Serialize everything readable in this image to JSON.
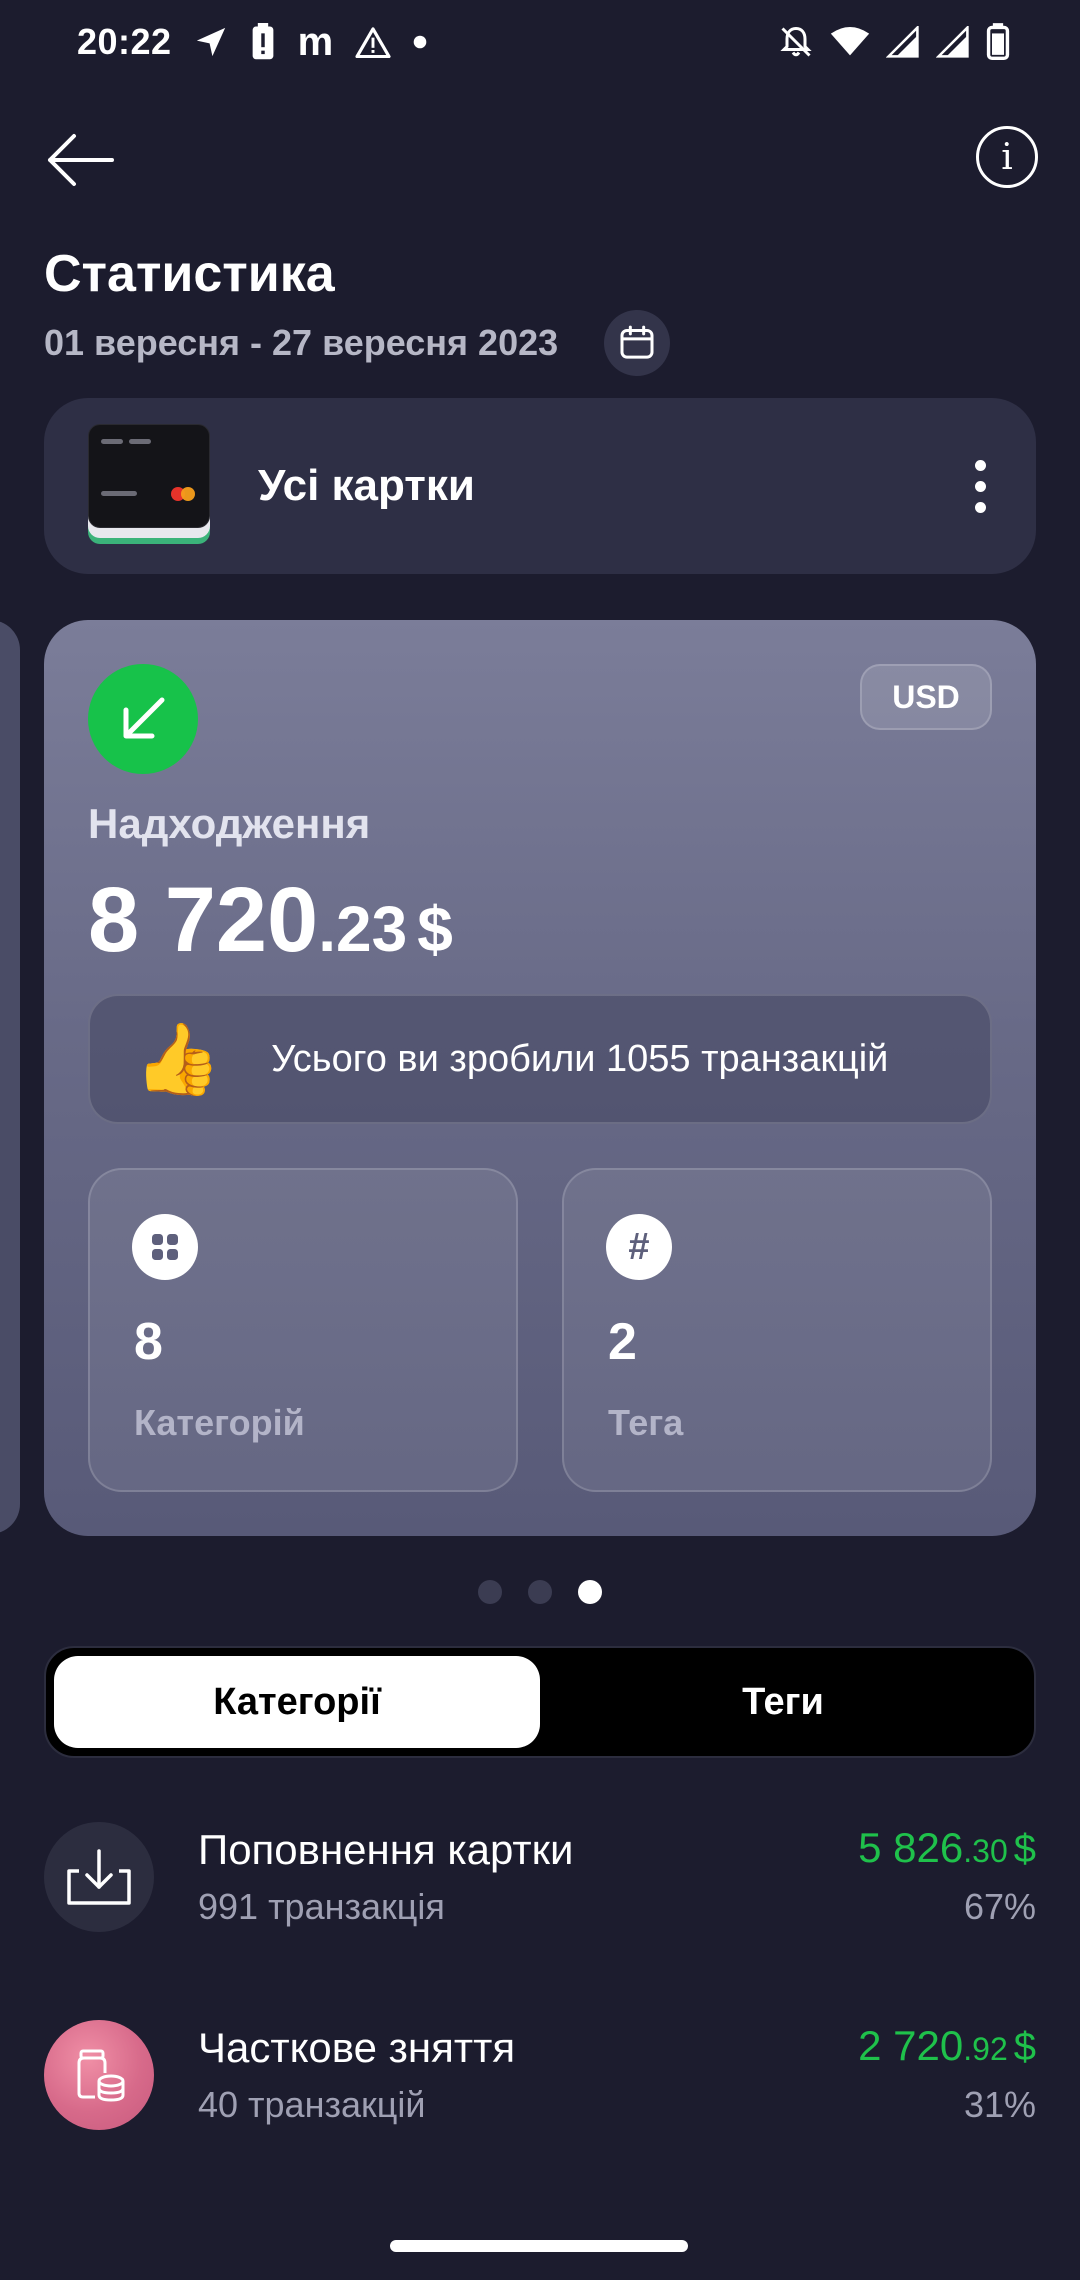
{
  "status_bar": {
    "time": "20:22",
    "left_icons": [
      "send-icon",
      "battery-alert-icon",
      "m-icon",
      "warning-icon",
      "dot-icon"
    ],
    "m_label": "m",
    "right_icons": [
      "notifications-off-icon",
      "wifi-icon",
      "signal-icon",
      "signal-icon",
      "battery-icon"
    ]
  },
  "header": {
    "title": "Статистика",
    "date_range": "01 вересня - 27 вересня 2023",
    "info_label": "i"
  },
  "card_selector": {
    "label": "Усі картки"
  },
  "stat_card": {
    "currency": "USD",
    "label": "Надходження",
    "amount_int": "8 720",
    "amount_dec": ".23",
    "amount_currency": "$",
    "transactions_text": "Усього ви зробили 1055 транзакцій",
    "thumb": "👍",
    "categories_count": "8",
    "categories_label": "Категорій",
    "tags_count": "2",
    "tags_label": "Тега",
    "tag_icon_glyph": "#"
  },
  "pager": {
    "count": 3,
    "active_index": 2
  },
  "tabs": {
    "categories": "Категорії",
    "tags": "Теги",
    "active": "categories"
  },
  "list": [
    {
      "title": "Поповнення картки",
      "subtitle": "991 транзакція",
      "amount_int": "5 826",
      "amount_dec": ".30",
      "amount_currency": "$",
      "percent": "67%",
      "icon": "download-icon"
    },
    {
      "title": "Часткове зняття",
      "subtitle": "40 транзакцій",
      "amount_int": "2 720",
      "amount_dec": ".92",
      "amount_currency": "$",
      "percent": "31%",
      "icon": "piggy-jar-icon"
    }
  ],
  "colors": {
    "background": "#1c1c2e",
    "income_green": "#17c24a",
    "amount_green": "#1fc14b",
    "secondary_text": "#9fa0b3"
  }
}
